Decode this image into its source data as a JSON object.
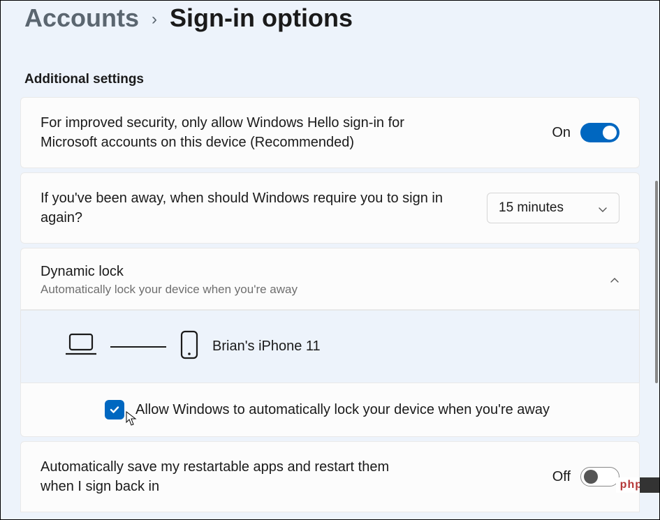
{
  "breadcrumb": {
    "parent": "Accounts",
    "current": "Sign-in options"
  },
  "section_title": "Additional settings",
  "hello_card": {
    "text": "For improved security, only allow Windows Hello sign-in for Microsoft accounts on this device (Recommended)",
    "state_label": "On",
    "state": true
  },
  "away_card": {
    "text": "If you've been away, when should Windows require you to sign in again?",
    "dropdown_value": "15 minutes"
  },
  "dynamic_lock": {
    "title": "Dynamic lock",
    "subtitle": "Automatically lock your device when you're away",
    "device_name": "Brian's iPhone 11",
    "checkbox_label": "Allow Windows to automatically lock your device when you're away",
    "checkbox_checked": true
  },
  "restart_apps": {
    "text": "Automatically save my restartable apps and restart them when I sign back in",
    "state_label": "Off",
    "state": false
  },
  "watermark": "php"
}
